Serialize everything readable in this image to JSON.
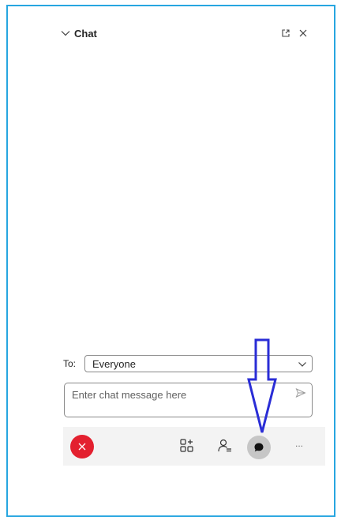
{
  "chat_panel": {
    "title": "Chat",
    "header_icons": [
      "chevron-down-icon",
      "popout-icon",
      "close-icon"
    ]
  },
  "composer": {
    "to_label": "To:",
    "recipient": "Everyone",
    "message_placeholder": "Enter chat message here",
    "message_value": ""
  },
  "toolbar": {
    "more_label": "...",
    "buttons": [
      "leave-button",
      "breakout-rooms-button",
      "participants-button",
      "chat-button",
      "more-button"
    ]
  },
  "colors": {
    "frame_border": "#27a6e0",
    "leave_button": "#e3202f",
    "annotation_arrow": "#2a2dd6",
    "chat_button_active": "#c6c6c6"
  }
}
